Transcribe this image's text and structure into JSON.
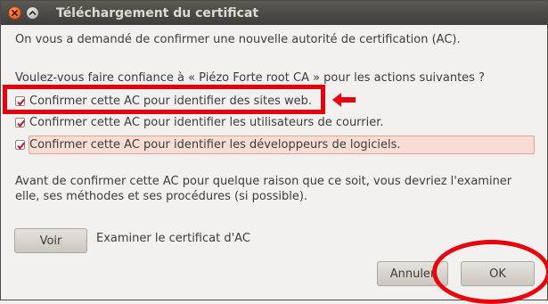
{
  "window": {
    "title": "Téléchargement du certificat"
  },
  "dialog": {
    "intro": "On vous a demandé de confirmer une nouvelle autorité de certification (AC).",
    "question": "Voulez-vous faire confiance à « Piézo Forte root CA » pour les actions suivantes ?",
    "options": [
      {
        "label": "Confirmer cette AC pour identifier des sites web.",
        "checked": true
      },
      {
        "label": "Confirmer cette AC pour identifier les utilisateurs de courrier.",
        "checked": true
      },
      {
        "label": "Confirmer cette AC pour identifier les développeurs de logiciels.",
        "checked": true
      }
    ],
    "advice_line1": "Avant de confirmer cette AC pour quelque raison que ce soit, vous devriez l'examiner",
    "advice_line2": "elle, ses méthodes et ses procédures (si possible).",
    "view_button": "Voir",
    "view_caption": "Examiner le certificat d'AC",
    "cancel_button": "Annuler",
    "ok_button": "OK"
  },
  "colors": {
    "accent_red": "#e8000b",
    "check_red": "#c8102e",
    "titlebar": "#3f3e3a"
  },
  "icons": [
    "close-icon",
    "maximize-icon",
    "checkmark-icon",
    "arrow-left-icon"
  ]
}
